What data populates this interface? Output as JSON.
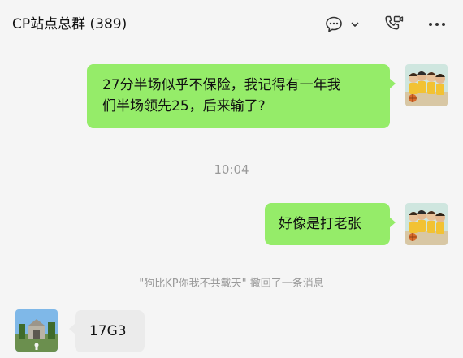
{
  "header": {
    "title": "CP站点总群 (389)",
    "icons": [
      "chat-bubble-icon",
      "chevron-down-icon",
      "video-call-icon",
      "more-icon"
    ]
  },
  "messages": [
    {
      "type": "outgoing",
      "text_line1": "27分半场似乎不保险，我记得有一年我",
      "text_line2": "们半场领先25，后来输了?"
    },
    {
      "type": "time",
      "text": "10:04"
    },
    {
      "type": "outgoing",
      "text": "好像是打老张"
    },
    {
      "type": "system",
      "text": "\"狗比KP你我不共戴天\" 撤回了一条消息"
    },
    {
      "type": "incoming",
      "text": "17G3"
    }
  ],
  "colors": {
    "outgoing_bubble": "#95ec69",
    "incoming_bubble": "#ebebeb",
    "background": "#f5f5f5",
    "muted_text": "#999999"
  }
}
